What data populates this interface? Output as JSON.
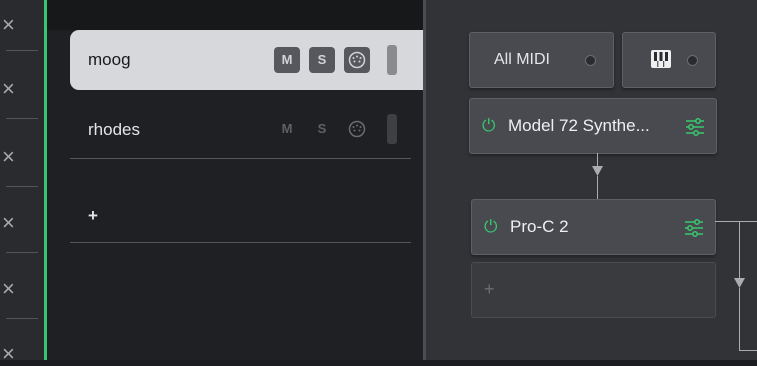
{
  "close_column": {
    "icon": "close-icon",
    "glyph": "×",
    "rows": 6
  },
  "tracks": [
    {
      "name": "moog",
      "selected": true,
      "mute": "M",
      "solo": "S"
    },
    {
      "name": "rhodes",
      "selected": false,
      "mute": "M",
      "solo": "S"
    }
  ],
  "add_track": {
    "label": "+"
  },
  "chain": {
    "midi_input": {
      "label": "All MIDI"
    },
    "devices": [
      {
        "name": "Model 72 Synthe...",
        "power_glyph": "⏻"
      },
      {
        "name": "Pro-C 2",
        "power_glyph": "⏻"
      }
    ],
    "add_slot": {
      "label": "+"
    }
  },
  "colors": {
    "accent_green": "#36c770",
    "selected_track_bg": "#d7d8db"
  }
}
